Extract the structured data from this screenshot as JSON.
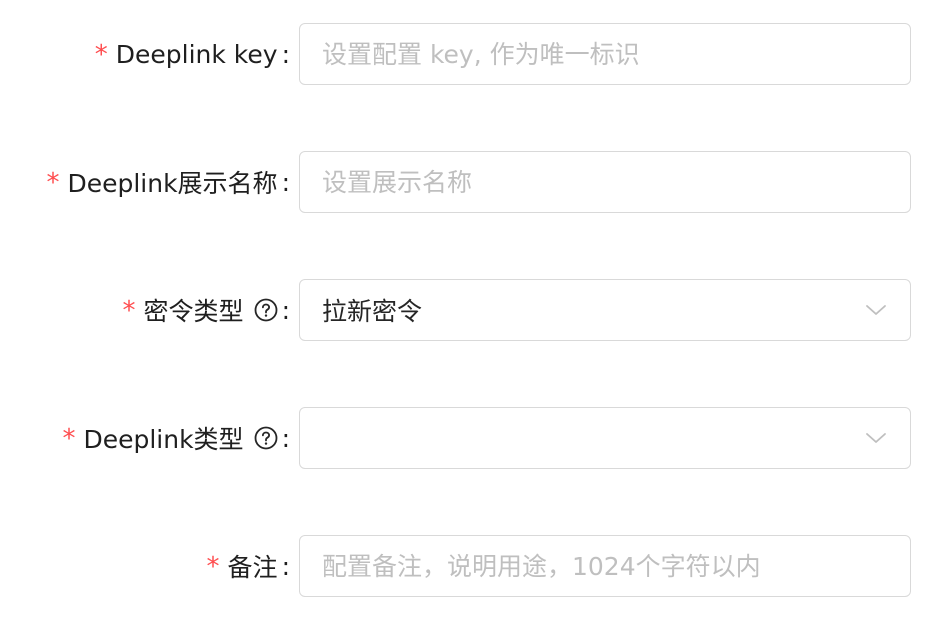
{
  "form": {
    "fields": [
      {
        "label": "Deeplink key",
        "required": true,
        "required_mark": "*",
        "colon": ":",
        "type": "input",
        "value": "",
        "placeholder": "设置配置 key, 作为唯一标识"
      },
      {
        "label": "Deeplink展示名称",
        "required": true,
        "required_mark": "*",
        "colon": ":",
        "type": "input",
        "value": "",
        "placeholder": "设置展示名称"
      },
      {
        "label": "密令类型",
        "required": true,
        "required_mark": "*",
        "colon": ":",
        "help_icon": "question-circle-icon",
        "type": "select",
        "value": "拉新密令"
      },
      {
        "label": "Deeplink类型",
        "required": true,
        "required_mark": "*",
        "colon": ":",
        "help_icon": "question-circle-icon",
        "type": "select",
        "value": ""
      },
      {
        "label": "备注",
        "required": true,
        "required_mark": "*",
        "colon": ":",
        "type": "input",
        "value": "",
        "placeholder": "配置备注，说明用途，1024个字符以内"
      }
    ]
  },
  "colors": {
    "required": "#ff4d4f",
    "border": "#d9d9d9",
    "placeholder": "#bfbfbf",
    "text": "#262626"
  }
}
